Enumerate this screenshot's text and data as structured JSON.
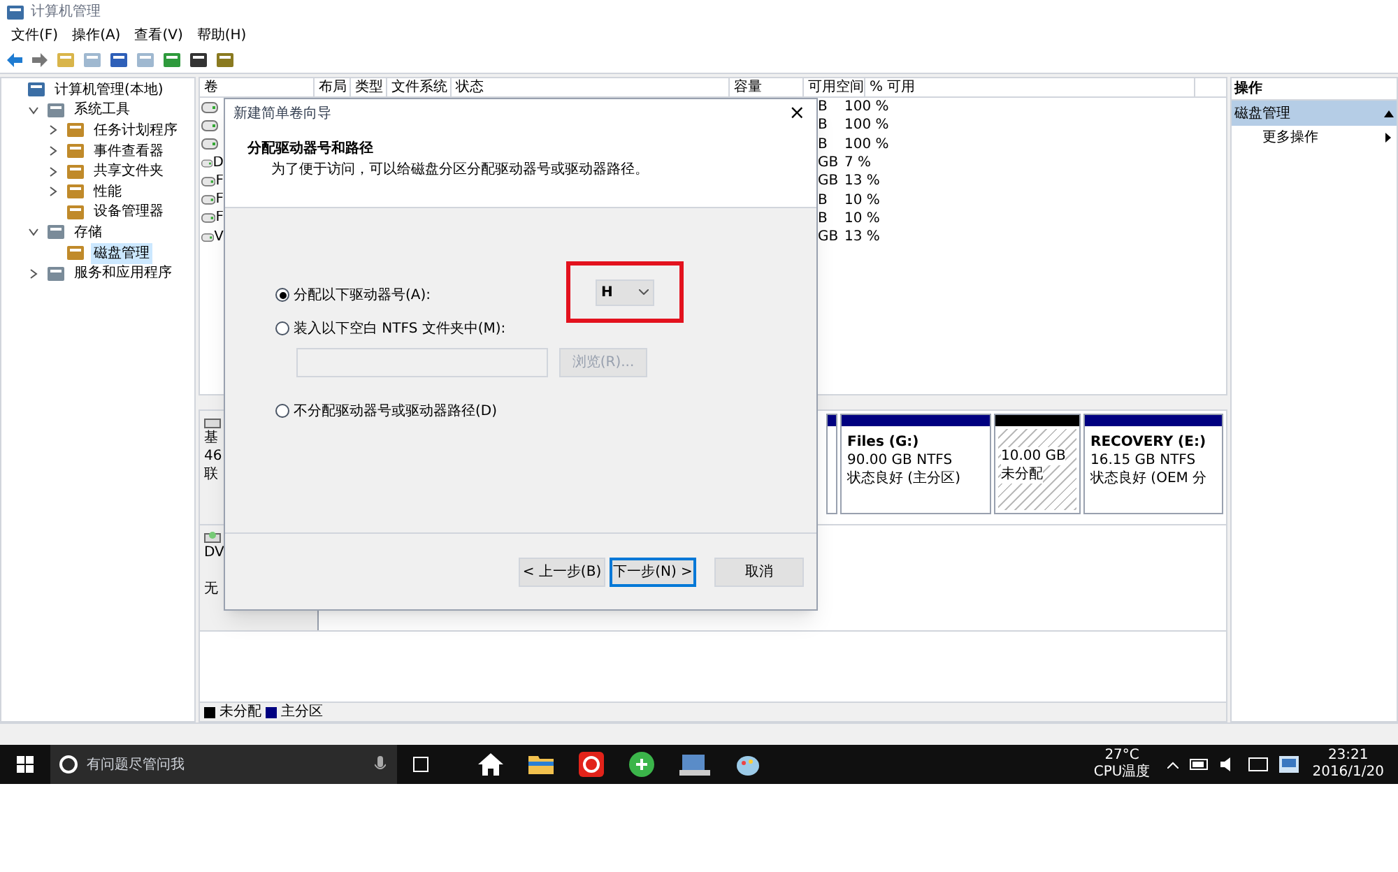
{
  "window": {
    "title": "计算机管理"
  },
  "menu": [
    "文件(F)",
    "操作(A)",
    "查看(V)",
    "帮助(H)"
  ],
  "tree": [
    {
      "label": "计算机管理(本地)",
      "selected": false,
      "children": [
        {
          "label": "系统工具",
          "selected": false,
          "expanded": true,
          "children": [
            {
              "label": "任务计划程序",
              "selected": false,
              "expanded": false
            },
            {
              "label": "事件查看器",
              "selected": false,
              "expanded": false
            },
            {
              "label": "共享文件夹",
              "selected": false,
              "expanded": false
            },
            {
              "label": "性能",
              "selected": false,
              "expanded": false
            },
            {
              "label": "设备管理器",
              "selected": false
            }
          ]
        },
        {
          "label": "存储",
          "selected": false,
          "expanded": true,
          "children": [
            {
              "label": "磁盘管理",
              "selected": true
            }
          ]
        },
        {
          "label": "服务和应用程序",
          "selected": false,
          "expanded": false
        }
      ]
    }
  ],
  "table": {
    "columns": [
      "卷",
      "布局",
      "类型",
      "文件系统",
      "状态",
      "容量",
      "可用空间",
      "% 可用"
    ],
    "rows": [
      {
        "free": "B",
        "percent": "100 %"
      },
      {
        "free": "B",
        "percent": "100 %"
      },
      {
        "free": "B",
        "percent": "100 %"
      },
      {
        "volume": "D",
        "free": "GB",
        "percent": "7 %"
      },
      {
        "volume": "F",
        "free": "GB",
        "percent": "13 %"
      },
      {
        "volume": "F",
        "free": "B",
        "percent": "10 %"
      },
      {
        "volume": "F",
        "free": "B",
        "percent": "10 %"
      },
      {
        "volume": "V",
        "free": "GB",
        "percent": "13 %"
      }
    ]
  },
  "disks": [
    {
      "kind": "hdd",
      "lines": [
        "基",
        "46",
        "联"
      ],
      "partitions": [
        {
          "kind": "primary"
        },
        {
          "kind": "primary",
          "name": "Files (G:)",
          "size": "90.00 GB NTFS",
          "status": "状态良好 (主分区)"
        },
        {
          "kind": "unallocated",
          "size": "10.00 GB",
          "status": "未分配"
        },
        {
          "kind": "primary",
          "name": "RECOVERY (E:)",
          "size": "16.15 GB NTFS",
          "status": "状态良好 (OEM 分"
        }
      ]
    },
    {
      "kind": "dvd",
      "lines": [
        "DV",
        "无"
      ]
    }
  ],
  "legend": [
    {
      "label": "未分配",
      "color": "#000000"
    },
    {
      "label": "主分区",
      "color": "#000080"
    }
  ],
  "actions": {
    "title": "操作",
    "section": "磁盘管理",
    "items": [
      "更多操作"
    ]
  },
  "dialog": {
    "title": "新建简单卷向导",
    "close": "×",
    "heading": "分配驱动器号和路径",
    "subtitle": "为了便于访问，可以给磁盘分区分配驱动器号或驱动器路径。",
    "options": [
      {
        "label": "分配以下驱动器号(A):",
        "selected": true
      },
      {
        "label": "装入以下空白 NTFS 文件夹中(M):",
        "selected": false
      },
      {
        "label": "不分配驱动器号或驱动器路径(D)",
        "selected": false
      }
    ],
    "drive_letter": "H",
    "browse": {
      "label": "浏览(R)...",
      "disabled": true
    },
    "buttons": [
      {
        "label": "< 上一步(B)",
        "focused": false
      },
      {
        "label": "下一步(N) >",
        "focused": true
      },
      {
        "label": "取消",
        "focused": false
      }
    ]
  },
  "taskbar": {
    "search_placeholder": "有问题尽管问我",
    "temperature": "27°C",
    "temperature_label": "CPU温度",
    "time": "23:21",
    "date": "2016/1/20"
  }
}
